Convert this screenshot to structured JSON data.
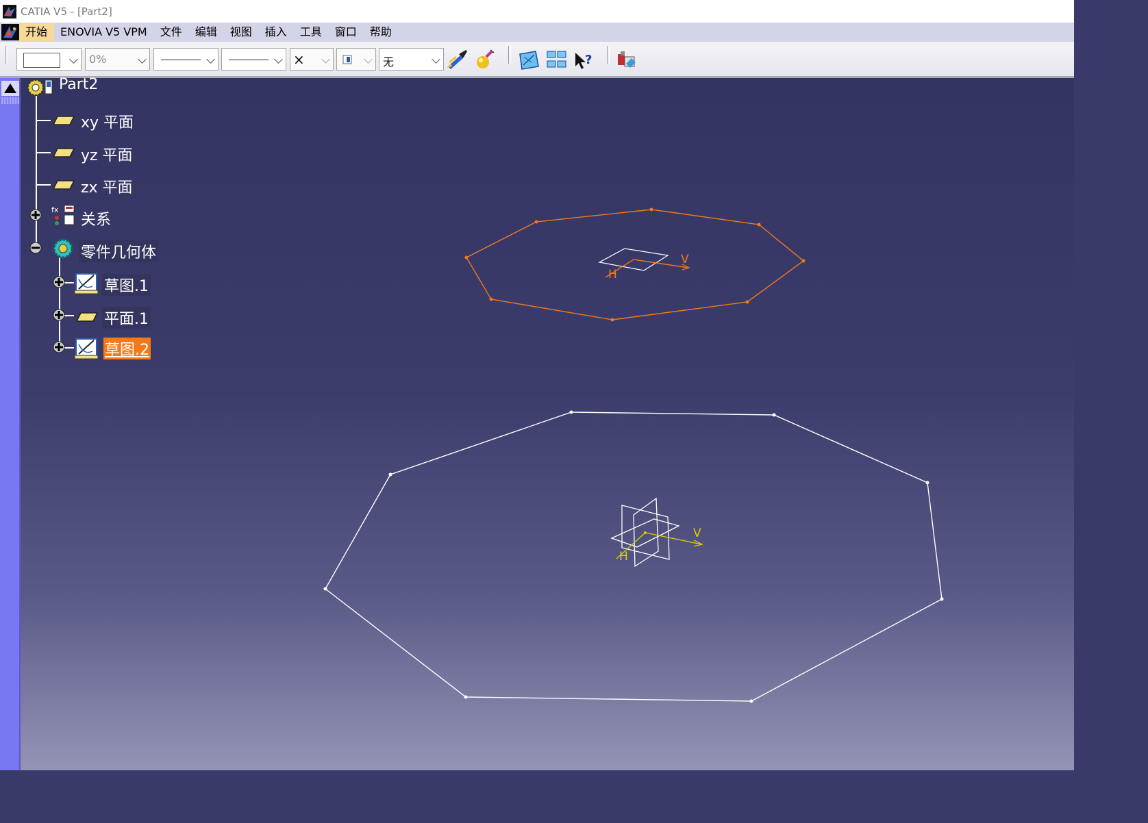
{
  "window": {
    "title": "CATIA V5 - [Part2]"
  },
  "menu": {
    "items": [
      {
        "label": "开始",
        "active": true
      },
      {
        "label": "ENOVIA V5 VPM"
      },
      {
        "label": "文件"
      },
      {
        "label": "编辑"
      },
      {
        "label": "视图"
      },
      {
        "label": "插入"
      },
      {
        "label": "工具"
      },
      {
        "label": "窗口"
      },
      {
        "label": "帮助"
      }
    ]
  },
  "toolbar": {
    "fill_color": "",
    "transparency": "0%",
    "line_type": "solid",
    "line_thickness": "solid",
    "point_symbol": "×",
    "layer": "无",
    "icons": [
      "painter-icon",
      "apply-material-icon",
      "sketcher-icon",
      "window-tile-icon",
      "whats-this-icon",
      "catalog-icon"
    ]
  },
  "tree": {
    "root": "Part2",
    "items": [
      {
        "label": "xy 平面",
        "icon": "plane-icon"
      },
      {
        "label": "yz 平面",
        "icon": "plane-icon"
      },
      {
        "label": "zx 平面",
        "icon": "plane-icon"
      },
      {
        "label": "关系",
        "icon": "relations-icon",
        "expander": "+"
      },
      {
        "label": "零件几何体",
        "icon": "part-body-icon",
        "expander": "−"
      },
      {
        "label": "草图.1",
        "icon": "sketch-icon",
        "expander": "+"
      },
      {
        "label": "平面.1",
        "icon": "plane-icon",
        "expander": "+"
      },
      {
        "label": "草图.2",
        "icon": "sketch-icon",
        "expander": "+",
        "selected": true
      }
    ]
  },
  "viewport": {
    "axis_label_h": "H",
    "axis_label_v": "V",
    "colors": {
      "selected_sketch": "#f07a1a",
      "sketch": "#ffffff",
      "axis": "#d8d000"
    }
  }
}
